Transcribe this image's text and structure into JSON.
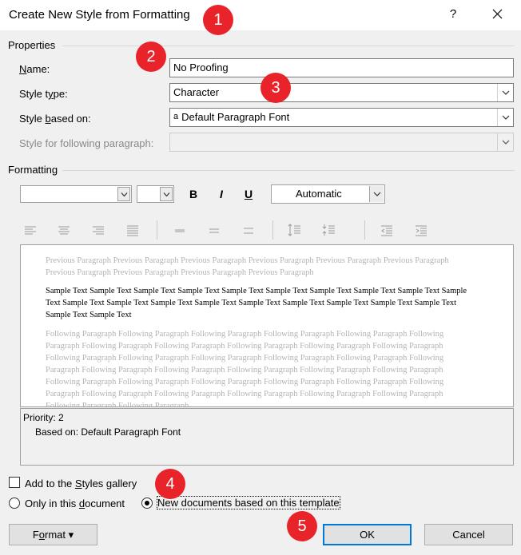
{
  "window": {
    "title": "Create New Style from Formatting",
    "help_label": "?",
    "close_icon": "close-icon"
  },
  "properties": {
    "section_label": "Properties",
    "name_label_pre": "",
    "name_label_key": "N",
    "name_label_post": "ame:",
    "name_value": "No Proofing",
    "style_type_label_pre": "Style t",
    "style_type_label_key": "y",
    "style_type_label_post": "pe:",
    "style_type_value": "Character",
    "based_on_label_pre": "Style ",
    "based_on_label_key": "b",
    "based_on_label_post": "ased on:",
    "based_on_icon": "a",
    "based_on_value": "Default Paragraph Font",
    "following_label": "Style for following paragraph:",
    "following_value": ""
  },
  "formatting": {
    "section_label": "Formatting",
    "font_value": "",
    "size_value": "",
    "bold_label": "B",
    "italic_label": "I",
    "underline_label": "U",
    "color_value": "Automatic"
  },
  "preview": {
    "previous_text": "Previous Paragraph Previous Paragraph Previous Paragraph Previous Paragraph Previous Paragraph Previous Paragraph Previous Paragraph Previous Paragraph Previous Paragraph Previous Paragraph",
    "sample_text": "Sample Text Sample Text Sample Text Sample Text Sample Text Sample Text Sample Text Sample Text Sample Text Sample Text Sample Text Sample Text Sample Text Sample Text Sample Text Sample Text Sample Text Sample Text Sample Text Sample Text Sample Text",
    "following_text": "Following Paragraph Following Paragraph Following Paragraph Following Paragraph Following Paragraph Following Paragraph Following Paragraph Following Paragraph Following Paragraph Following Paragraph Following Paragraph Following Paragraph Following Paragraph Following Paragraph Following Paragraph Following Paragraph Following Paragraph Following Paragraph Following Paragraph Following Paragraph Following Paragraph Following Paragraph Following Paragraph Following Paragraph Following Paragraph Following Paragraph Following Paragraph Following Paragraph Following Paragraph Following Paragraph Following Paragraph Following Paragraph Following Paragraph Following Paragraph Following Paragraph"
  },
  "description": {
    "line1": "Priority: 2",
    "line2": "Based on: Default Paragraph Font"
  },
  "options": {
    "add_to_gallery_pre": "Add to the ",
    "add_to_gallery_key": "S",
    "add_to_gallery_post": "tyles gallery",
    "add_to_gallery_checked": false,
    "only_doc_pre": "Only in this ",
    "only_doc_key": "d",
    "only_doc_post": "ocument",
    "only_doc_selected": false,
    "new_docs_label": "New documents based on this template",
    "new_docs_selected": true
  },
  "buttons": {
    "format_pre": "F",
    "format_key": "o",
    "format_post": "rmat",
    "format_arrow": "▾",
    "ok_label": "OK",
    "cancel_label": "Cancel"
  },
  "badges": [
    "1",
    "2",
    "3",
    "4",
    "5"
  ],
  "colors": {
    "badge": "#e8242a",
    "default_button_border": "#0078d7",
    "dialog_bg": "#f0f0f0"
  }
}
